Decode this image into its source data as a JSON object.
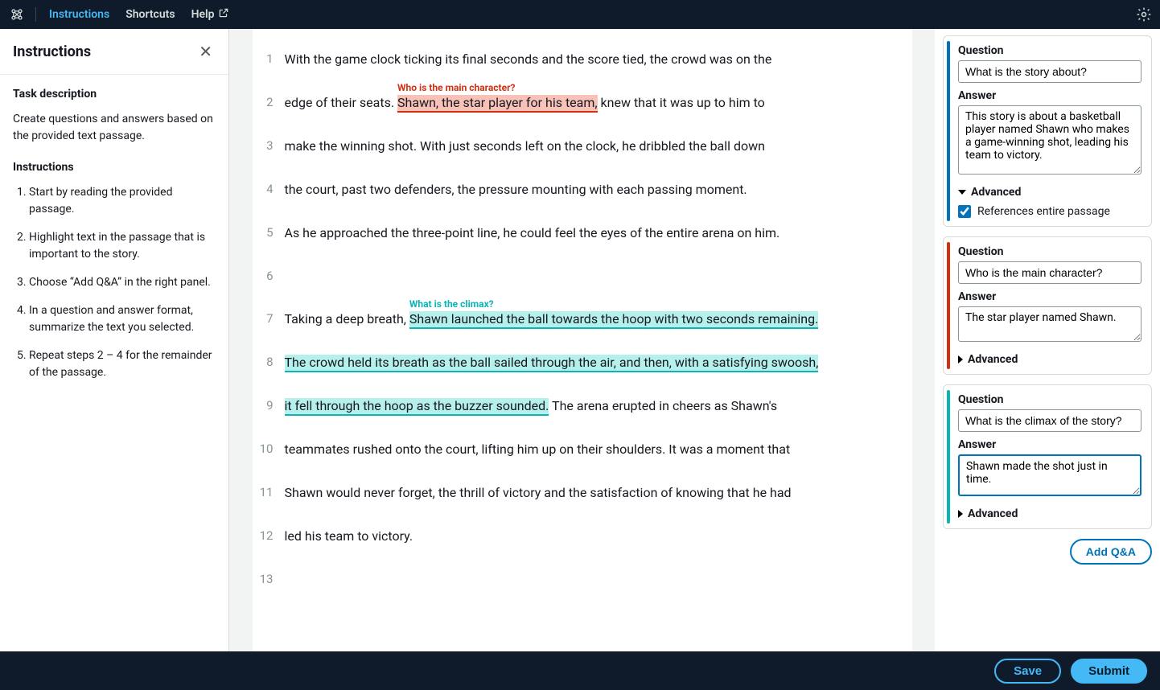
{
  "topbar": {
    "instructions": "Instructions",
    "shortcuts": "Shortcuts",
    "help": "Help"
  },
  "sidebar": {
    "title": "Instructions",
    "task_heading": "Task description",
    "task_desc": "Create questions and answers based on the provided text passage.",
    "instr_heading": "Instructions",
    "steps": [
      "Start by reading the provided passage.",
      "Highlight text in the passage that is important to the story.",
      "Choose “Add Q&A” in the right panel.",
      "In a question and answer format, summarize the text you selected.",
      "Repeat steps 2 – 4 for the remainder of the passage."
    ]
  },
  "passage": {
    "annot_red": "Who is the main character?",
    "annot_teal": "What is the climax?",
    "lines": {
      "l1": "With the game clock ticking its final seconds and the score tied, the crowd was on the",
      "l2a": " edge of their seats. ",
      "l2_hl": "Shawn, the star player for his team,",
      "l2b": " knew that it was up to him to",
      "l3": "make the winning shot. With just seconds left on the clock, he dribbled the ball down",
      "l4": "the court, past two defenders, the pressure mounting with each passing moment.",
      "l5": "As he approached the three-point line, he could feel the eyes of the entire arena on him.",
      "l6": "",
      "l7a": "Taking a deep breath, ",
      "l7_hl": "Shawn launched the ball towards the hoop with two seconds remaining.",
      "l8_hl": "The crowd held its breath as the ball sailed through the air, and then, with a satisfying swoosh,",
      "l9_hl": "it fell through the hoop as the buzzer sounded.",
      "l9b": " The arena erupted in cheers as Shawn's",
      "l10": " teammates rushed onto the court, lifting him up on their shoulders. It was a moment that",
      "l11": "Shawn would never forget, the thrill of victory and the satisfaction of knowing that he had",
      "l12": "led his team to victory.",
      "l13": ""
    }
  },
  "qa": [
    {
      "q_label": "Question",
      "a_label": "Answer",
      "question": "What is the story about?",
      "answer": "This story is about a basketball player named Shawn who makes a game-winning shot, leading his team to victory.",
      "adv_label": "Advanced",
      "ref_label": "References entire passage"
    },
    {
      "q_label": "Question",
      "a_label": "Answer",
      "question": "Who is the main character?",
      "answer": "The star player named Shawn.",
      "adv_label": "Advanced"
    },
    {
      "q_label": "Question",
      "a_label": "Answer",
      "question": "What is the climax of the story?",
      "answer": "Shawn made the shot just in time.",
      "adv_label": "Advanced"
    }
  ],
  "buttons": {
    "add_qa": "Add Q&A",
    "save": "Save",
    "submit": "Submit"
  }
}
